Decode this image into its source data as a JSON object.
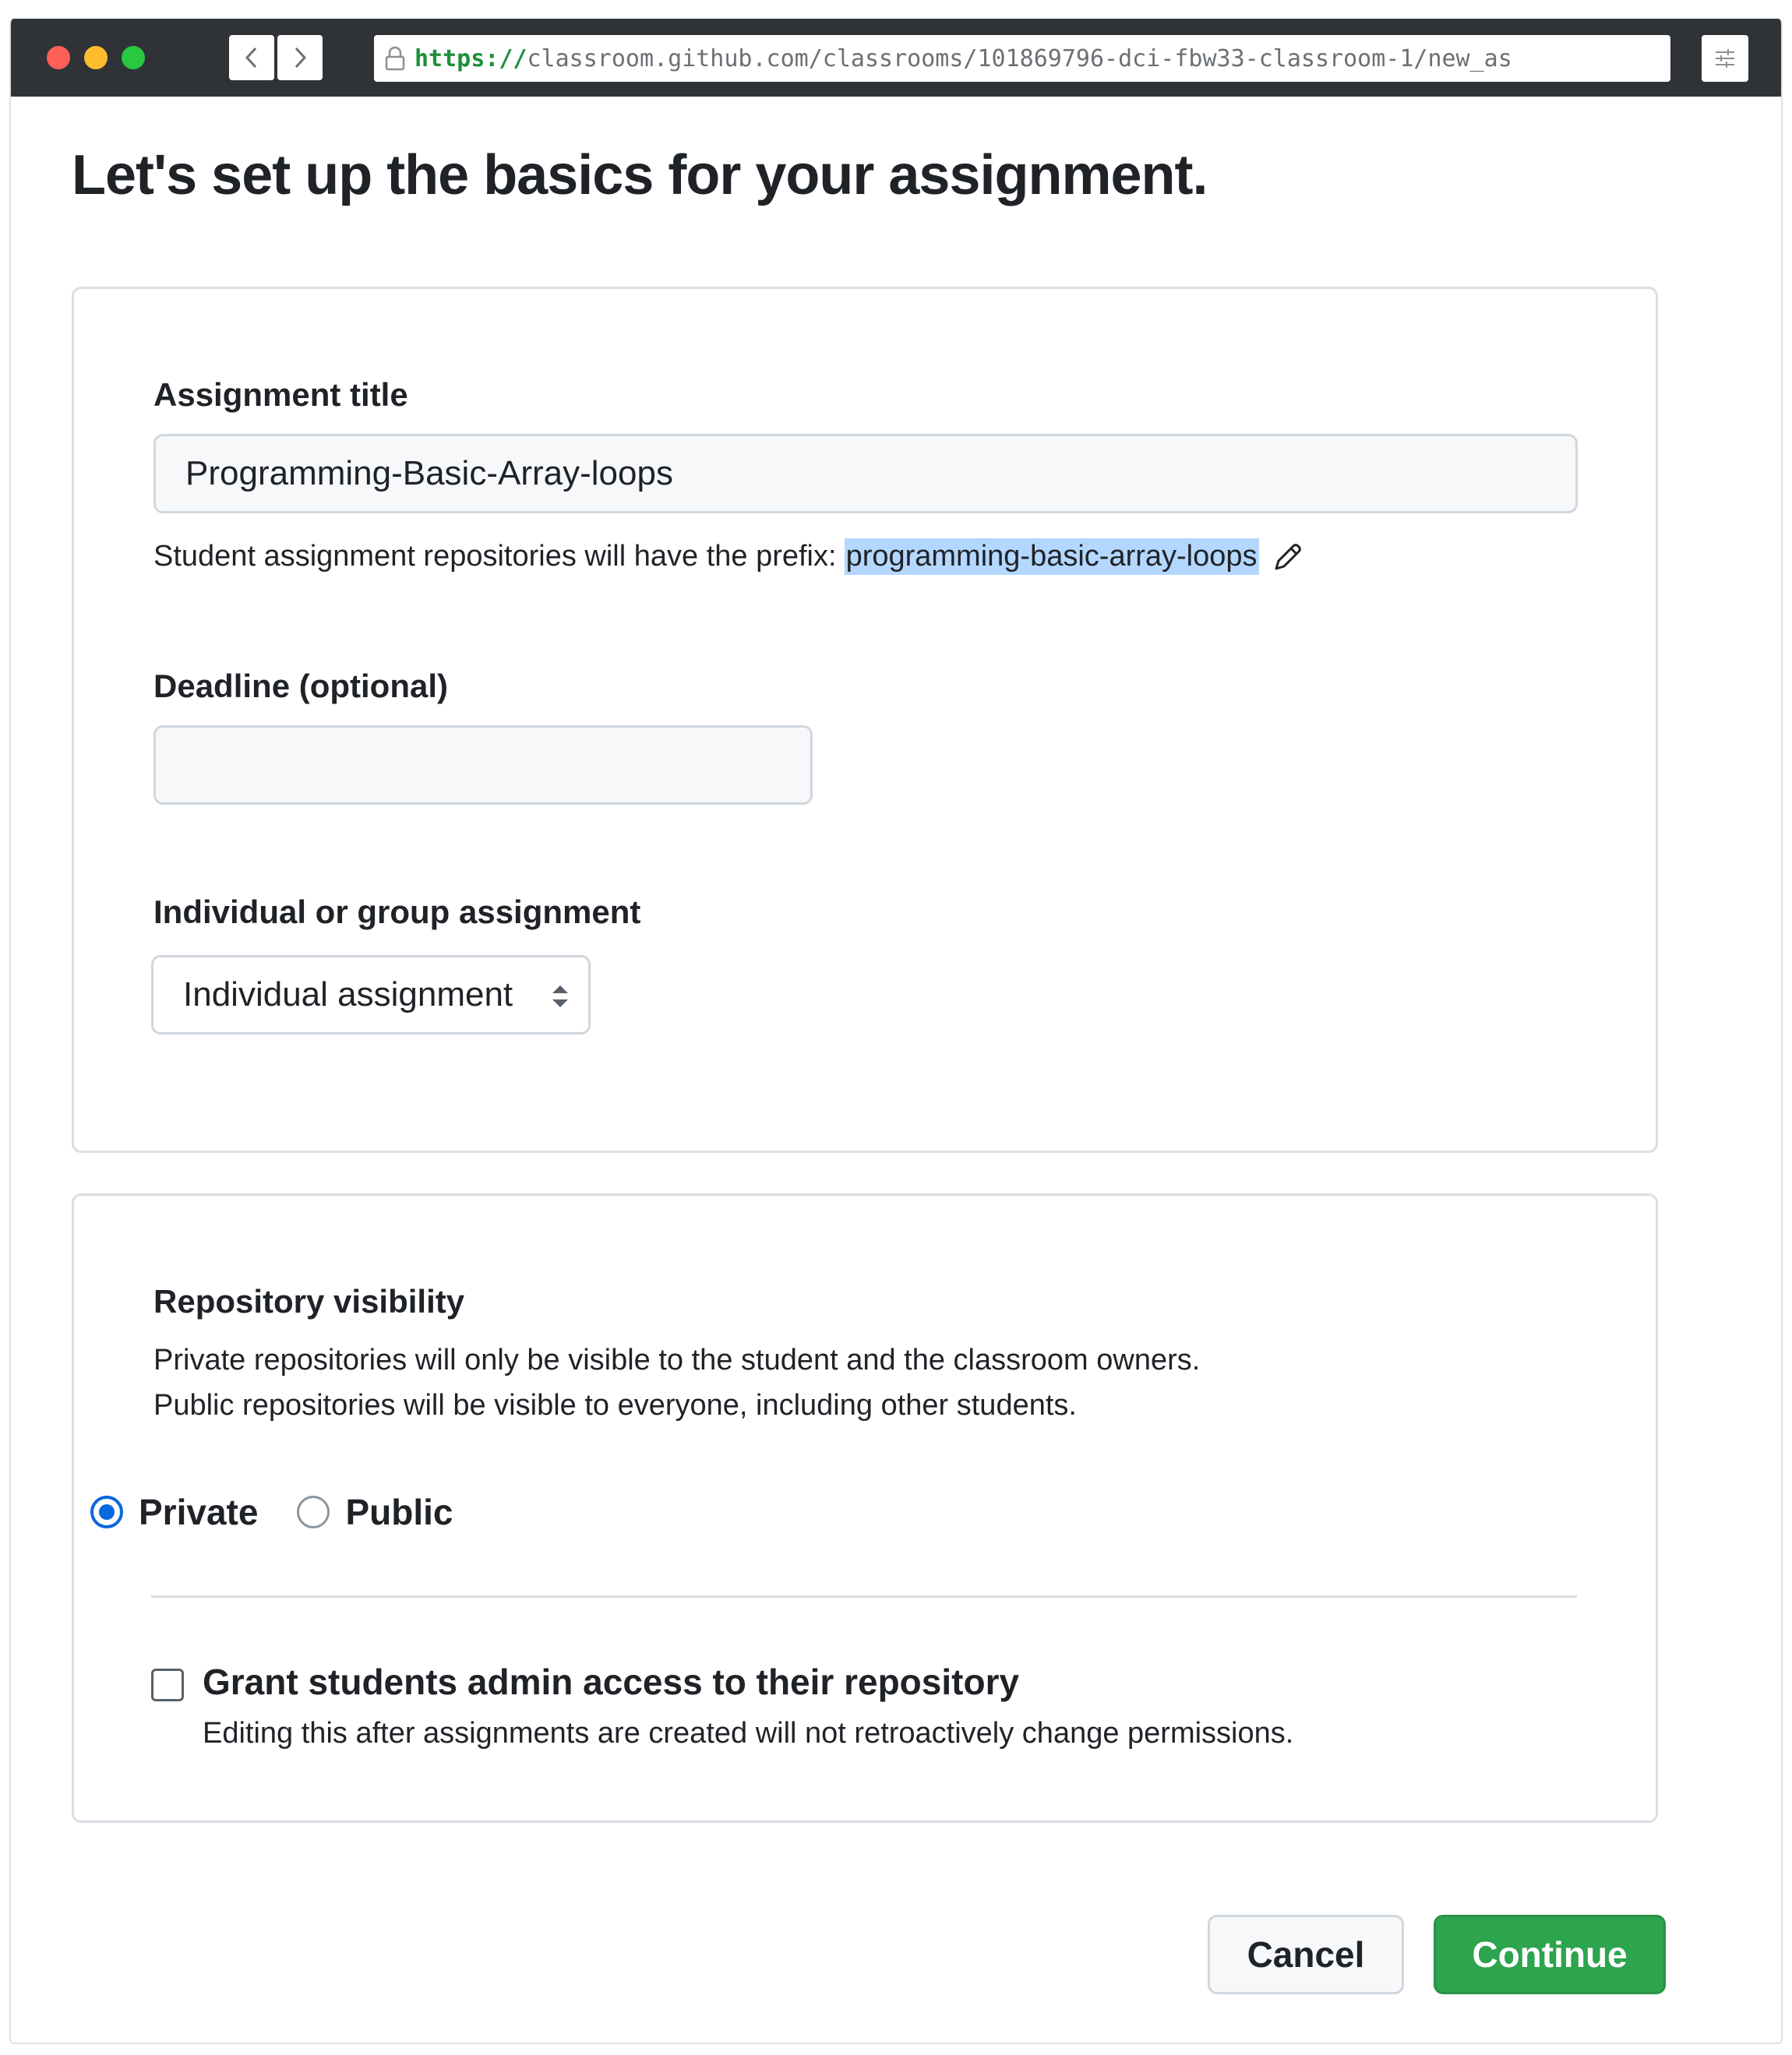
{
  "browser": {
    "url_scheme": "https://",
    "url_rest": "classroom.github.com/classrooms/101869796-dci-fbw33-classroom-1/new_as"
  },
  "page": {
    "heading": "Let's set up the basics for your assignment."
  },
  "basics": {
    "title_label": "Assignment title",
    "title_value": "Programming-Basic-Array-loops",
    "prefix_hint": "Student assignment repositories will have the prefix:",
    "prefix_value": "programming-basic-array-loops",
    "deadline_label": "Deadline (optional)",
    "deadline_value": "",
    "type_label": "Individual or group assignment",
    "type_selected": "Individual assignment"
  },
  "visibility": {
    "label": "Repository visibility",
    "desc_private": "Private repositories will only be visible to the student and the classroom owners.",
    "desc_public": "Public repositories will be visible to everyone, including other students.",
    "options": [
      {
        "label": "Private",
        "checked": true
      },
      {
        "label": "Public",
        "checked": false
      }
    ],
    "admin_label": "Grant students admin access to their repository",
    "admin_note": "Editing this after assignments are created will not retroactively change permissions.",
    "admin_checked": false
  },
  "actions": {
    "cancel": "Cancel",
    "continue": "Continue"
  },
  "colors": {
    "accent_blue": "#0969da",
    "continue_green": "#2da44e",
    "highlight": "#b4d7ff"
  }
}
